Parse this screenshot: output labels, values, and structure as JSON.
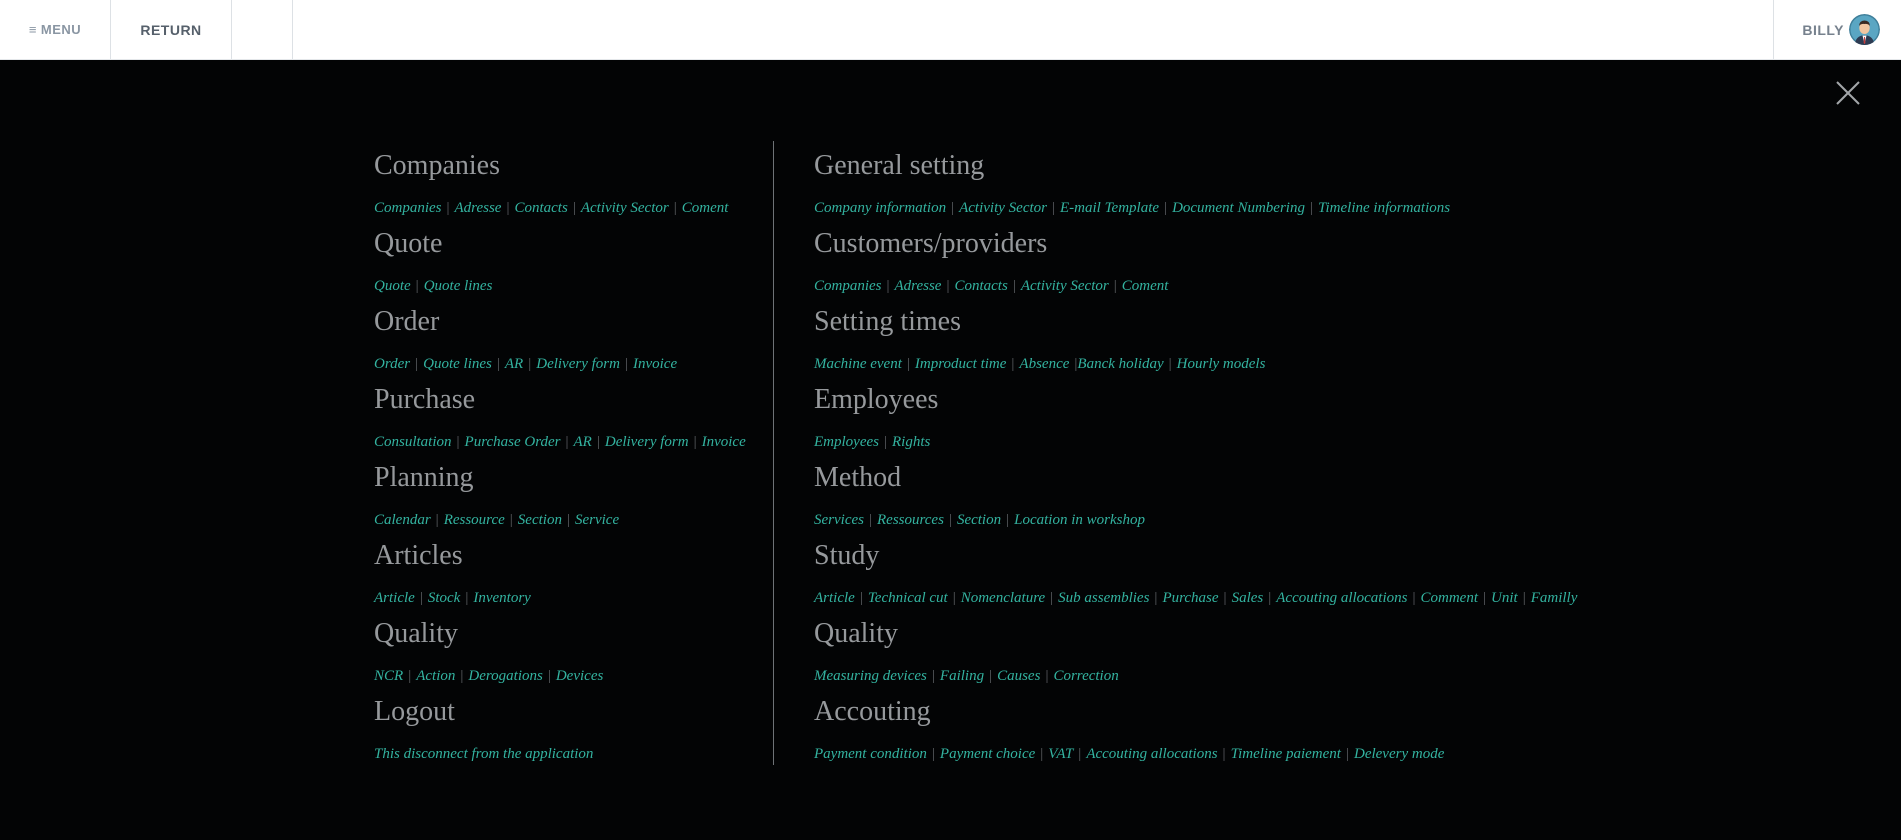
{
  "topbar": {
    "menu_icon": "≡",
    "menu_label": "MENU",
    "return_label": "RETURN",
    "user_name": "BILLY"
  },
  "overlay": {
    "close_icon": "close-icon"
  },
  "left_sections": [
    {
      "title": "Companies",
      "links": [
        "Companies",
        "Adresse",
        "Contacts",
        "Activity Sector",
        "Coment"
      ]
    },
    {
      "title": "Quote",
      "links": [
        "Quote",
        "Quote lines"
      ]
    },
    {
      "title": "Order",
      "links": [
        "Order",
        "Quote lines",
        "AR",
        "Delivery form",
        "Invoice"
      ]
    },
    {
      "title": "Purchase",
      "links": [
        "Consultation",
        "Purchase Order",
        "AR",
        "Delivery form",
        "Invoice"
      ]
    },
    {
      "title": "Planning",
      "links": [
        "Calendar",
        "Ressource",
        "Section",
        "Service"
      ]
    },
    {
      "title": "Articles",
      "links": [
        "Article",
        "Stock",
        "Inventory"
      ]
    },
    {
      "title": "Quality",
      "links": [
        "NCR",
        "Action",
        "Derogations",
        "Devices"
      ]
    },
    {
      "title": "Logout",
      "links": [
        "This disconnect from the application"
      ]
    }
  ],
  "right_sections": [
    {
      "title": "General setting",
      "links": [
        "Company information",
        "Activity Sector",
        "E-mail Template",
        "Document Numbering",
        "Timeline informations"
      ]
    },
    {
      "title": "Customers/providers",
      "links": [
        "Companies",
        "Adresse",
        "Contacts",
        "Activity Sector",
        "Coment"
      ]
    },
    {
      "title": "Setting times",
      "links": [
        "Machine event",
        "Improduct time",
        "Absence",
        "Banck holiday",
        "Hourly models"
      ]
    },
    {
      "title": "Employees",
      "links": [
        "Employees",
        "Rights"
      ]
    },
    {
      "title": "Method",
      "links": [
        "Services",
        "Ressources",
        "Section",
        "Location in workshop"
      ]
    },
    {
      "title": "Study",
      "links": [
        "Article",
        "Technical cut",
        "Nomenclature",
        "Sub assemblies",
        "Purchase",
        "Sales",
        "Accouting allocations",
        "Comment",
        "Unit",
        "Familly"
      ]
    },
    {
      "title": "Quality",
      "links": [
        "Measuring devices",
        "Failing",
        "Causes",
        "Correction"
      ]
    },
    {
      "title": "Accouting",
      "links": [
        "Payment condition",
        "Payment choice",
        "VAT",
        "Accouting allocations",
        "Timeline paiement",
        "Delevery mode"
      ]
    }
  ],
  "separator": "|",
  "colors": {
    "accent_link": "#33b3a0",
    "heading": "#96999c",
    "overlay_bg": "#030405"
  }
}
